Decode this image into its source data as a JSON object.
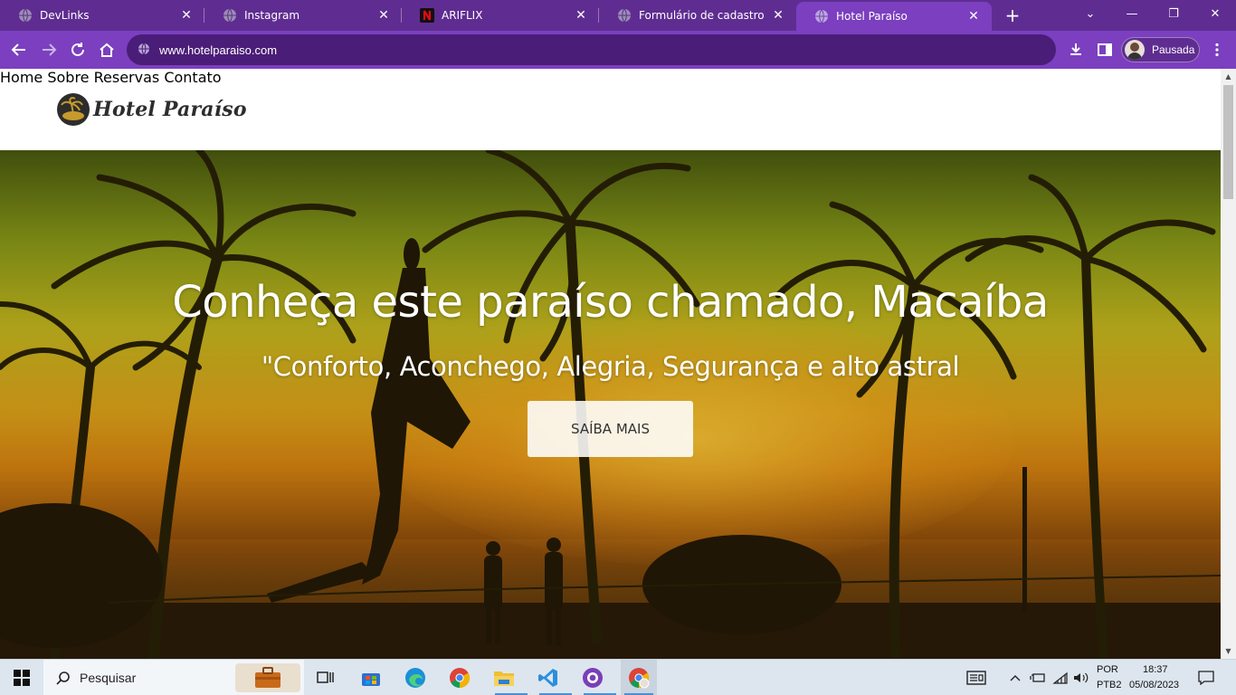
{
  "browser": {
    "tabs": [
      {
        "title": "DevLinks",
        "favicon": "globe-icon",
        "active": false
      },
      {
        "title": "Instagram",
        "favicon": "globe-icon",
        "active": false
      },
      {
        "title": "ARIFLIX",
        "favicon": "netflix-icon",
        "active": false
      },
      {
        "title": "Formulário de cadastro",
        "favicon": "globe-icon",
        "active": false
      },
      {
        "title": "Hotel Paraíso",
        "favicon": "globe-icon",
        "active": true
      }
    ],
    "url": "www.hotelparaiso.com",
    "profile_label": "Pausada",
    "colors": {
      "frame": "#5f2d91",
      "toolbar": "#7b3fbf",
      "omnibox": "#4a1d78"
    }
  },
  "site": {
    "logo_text": "Hotel Paraíso",
    "nav": [
      "Home",
      "Sobre",
      "Reservas",
      "Contato"
    ],
    "hero": {
      "title": "Conheça este paraíso chamado, Macaíba",
      "subtitle": "\"Conforto, Aconchego, Alegria, Segurança e alto astral",
      "cta": "SAÍBA MAIS"
    }
  },
  "taskbar": {
    "search_placeholder": "Pesquisar",
    "apps": [
      "work-briefcase-icon",
      "task-view-icon",
      "microsoft-store-icon",
      "edge-icon",
      "chrome-icon",
      "file-explorer-icon",
      "vscode-icon",
      "github-desktop-icon",
      "chrome-profile-icon"
    ],
    "language_line1": "POR",
    "language_line2": "PTB2",
    "time": "18:37",
    "date": "05/08/2023"
  }
}
